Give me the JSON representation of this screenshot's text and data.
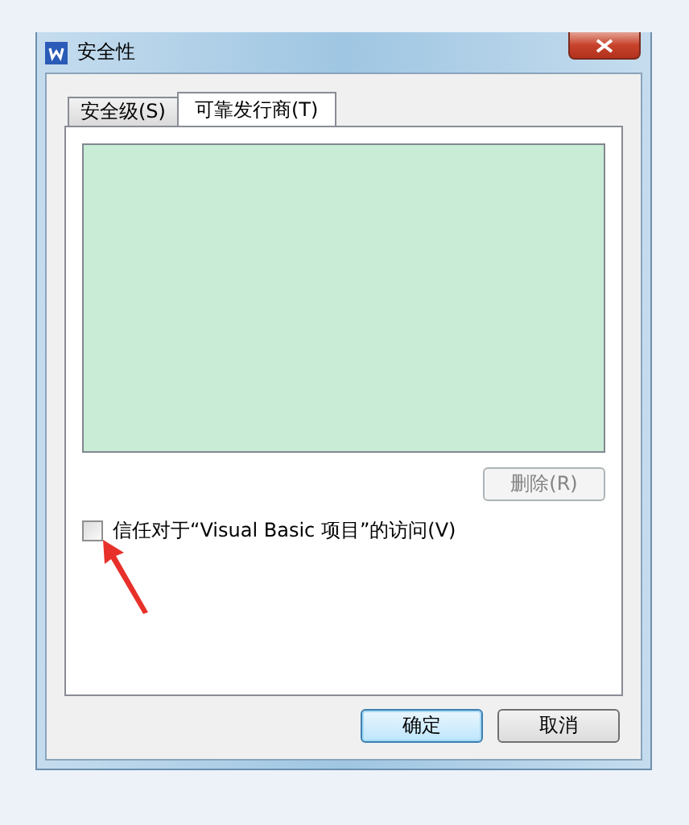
{
  "window": {
    "title": "安全性"
  },
  "tabs": [
    {
      "label": "安全级(S)",
      "selected": false
    },
    {
      "label": "可靠发行商(T)",
      "selected": true
    }
  ],
  "publishers": {
    "delete_button": {
      "label": "删除(R)",
      "disabled": true
    }
  },
  "trust_vba": {
    "label": "信任对于“Visual Basic 项目”的访问(V)",
    "checked": false
  },
  "buttons": [
    {
      "label": "确定",
      "default": true
    },
    {
      "label": "取消",
      "default": false
    }
  ]
}
